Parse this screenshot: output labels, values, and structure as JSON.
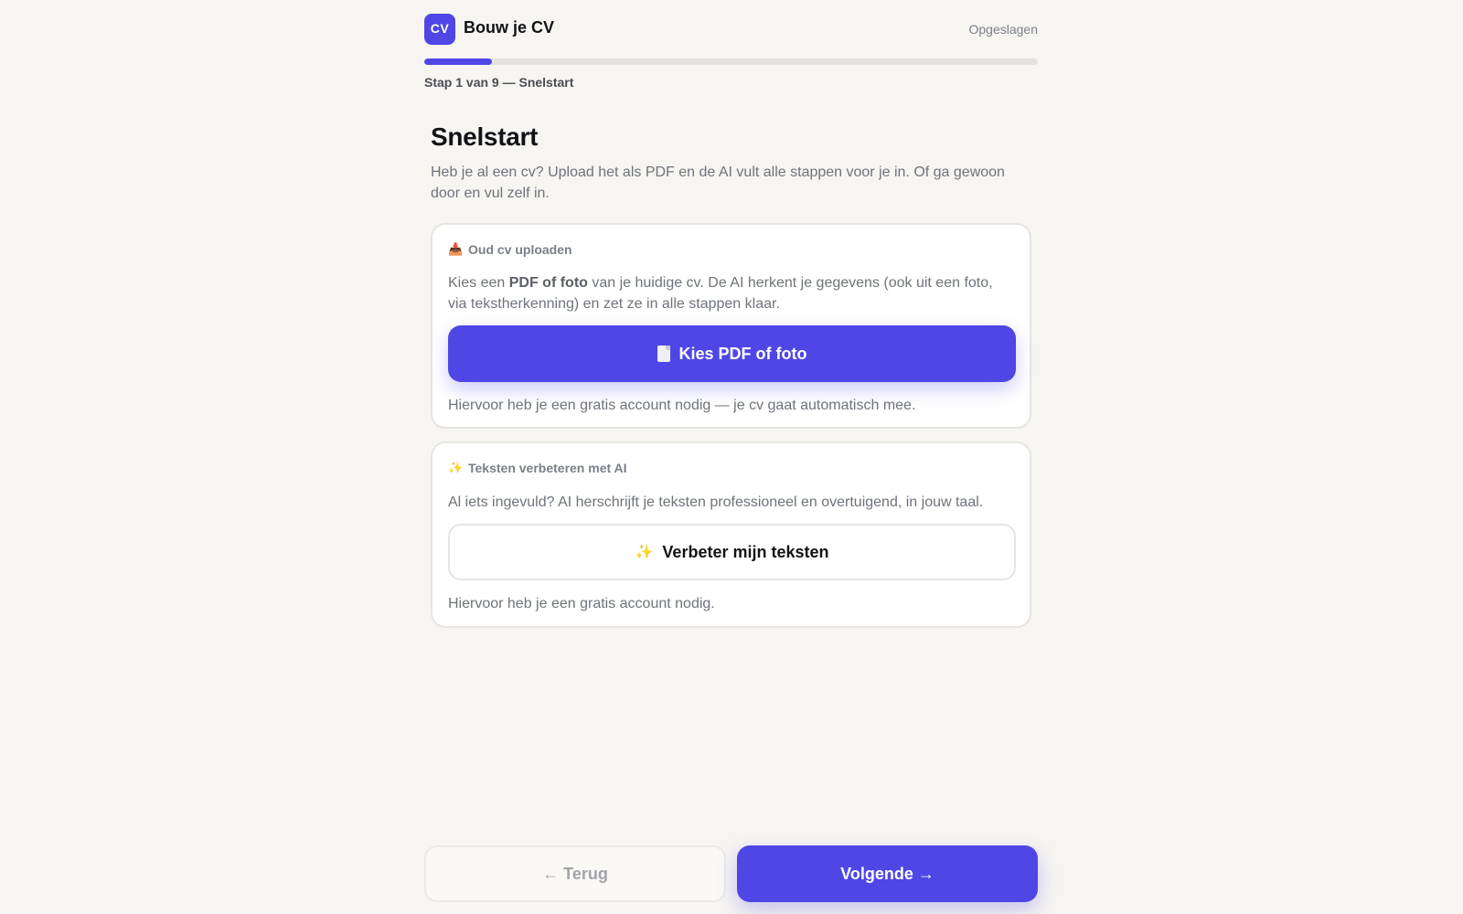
{
  "header": {
    "logo_text": "CV",
    "title": "Bouw je CV",
    "save_status": "Opgeslagen"
  },
  "progress": {
    "current_step": 1,
    "total_steps": 9,
    "fraction": 0.11,
    "label": "Stap 1 van 9 — Snelstart"
  },
  "main": {
    "title": "Snelstart",
    "description": "Heb je al een cv? Upload het als PDF en de AI vult alle stappen voor je in. Of ga gewoon door en vul zelf in.",
    "upload_card": {
      "icon": "inbox-tray-icon",
      "icon_glyph": "📥",
      "title": "Oud cv uploaden",
      "body_prefix": "Kies een ",
      "body_bold": "PDF of foto",
      "body_suffix": " van je huidige cv. De AI herkent je gegevens (ook uit een foto, via tekstherkenning) en zet ze in alle stappen klaar.",
      "button_icon": "document-icon",
      "button_label": "Kies PDF of foto",
      "note": "Hiervoor heb je een gratis account nodig — je cv gaat automatisch mee."
    },
    "ai_card": {
      "icon": "sparkles-icon",
      "icon_glyph": "✨",
      "title": "Teksten verbeteren met AI",
      "body": "Al iets ingevuld? AI herschrijft je teksten professioneel en overtuigend, in jouw taal.",
      "button_icon": "sparkles-icon",
      "button_glyph": "✨",
      "button_label": "Verbeter mijn teksten",
      "note": "Hiervoor heb je een gratis account nodig."
    }
  },
  "footer": {
    "back_label": "← Terug",
    "next_label": "Volgende →"
  },
  "colors": {
    "accent": "#4f46e5",
    "background": "#f6f5f1",
    "card": "#ffffff",
    "muted_text": "#6f737c"
  }
}
